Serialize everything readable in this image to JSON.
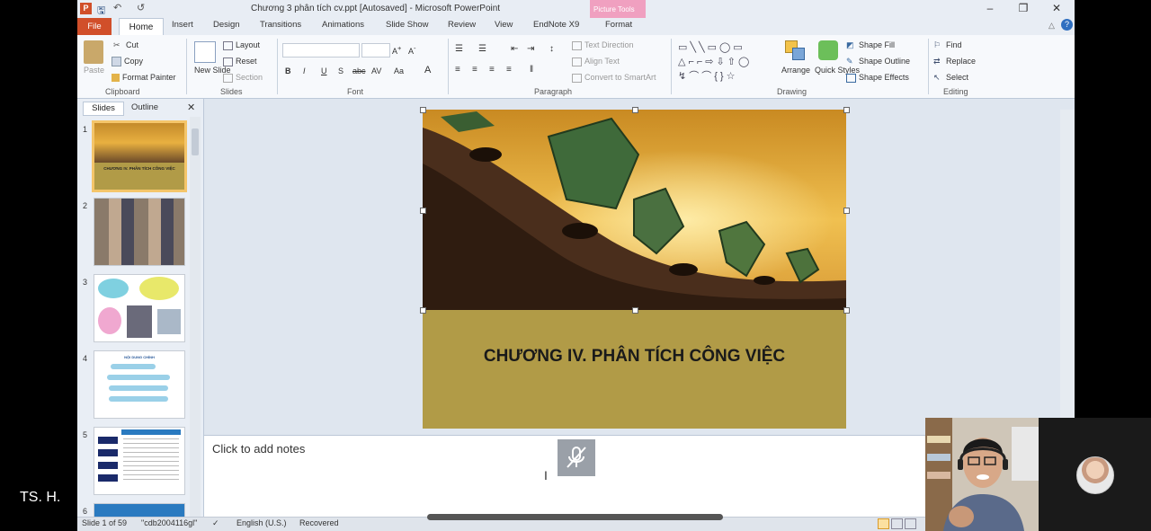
{
  "window": {
    "title": "Chương 3  phân tích cv.ppt [Autosaved]  -  Microsoft PowerPoint",
    "context_tab_group": "Picture Tools",
    "controls": [
      "–",
      "❐",
      "✕"
    ]
  },
  "tabs": [
    "File",
    "Home",
    "Insert",
    "Design",
    "Transitions",
    "Animations",
    "Slide Show",
    "Review",
    "View",
    "EndNote X9",
    "Format"
  ],
  "ribbon": {
    "clipboard": {
      "paste": "Paste",
      "cut": "Cut",
      "copy": "Copy",
      "format_painter": "Format Painter",
      "label": "Clipboard"
    },
    "slides": {
      "new_slide": "New Slide",
      "layout": "Layout",
      "reset": "Reset",
      "section": "Section",
      "label": "Slides"
    },
    "font": {
      "label": "Font",
      "bold": "B",
      "italic": "I",
      "underline": "U",
      "strike": "S",
      "shadow": "abc",
      "spacing": "AV",
      "case": "Aa",
      "color": "A"
    },
    "paragraph": {
      "text_direction": "Text Direction",
      "align_text": "Align Text",
      "smartart": "Convert to SmartArt",
      "label": "Paragraph"
    },
    "drawing": {
      "arrange": "Arrange",
      "quick_styles": "Quick Styles",
      "shape_fill": "Shape Fill",
      "shape_outline": "Shape Outline",
      "shape_effects": "Shape Effects",
      "label": "Drawing"
    },
    "editing": {
      "find": "Find",
      "replace": "Replace",
      "select": "Select",
      "label": "Editing"
    }
  },
  "panel": {
    "tab_slides": "Slides",
    "tab_outline": "Outline",
    "close": "✕",
    "slide_numbers": [
      "1",
      "2",
      "3",
      "4",
      "5",
      "6"
    ],
    "thumb1_title": "CHƯƠNG IV. PHÂN TÍCH CÔNG VIỆC",
    "thumb4_heading": "NỘI DUNG CHÍNH"
  },
  "slide": {
    "title": "CHƯƠNG IV. PHÂN TÍCH CÔNG VIỆC"
  },
  "notes": {
    "placeholder": "Click to add notes"
  },
  "status": {
    "slide_of": "Slide 1 of 59",
    "theme": "\"cdb2004116gl\"",
    "language": "English (U.S.)",
    "recovered": "Recovered"
  },
  "call": {
    "speaker_name": "TS. H."
  },
  "colors": {
    "file_tab": "#d14f2a",
    "picture_tools": "#f0a0c0",
    "slide_band": "#b19b47",
    "selected_thumb": "#f4c56a"
  }
}
